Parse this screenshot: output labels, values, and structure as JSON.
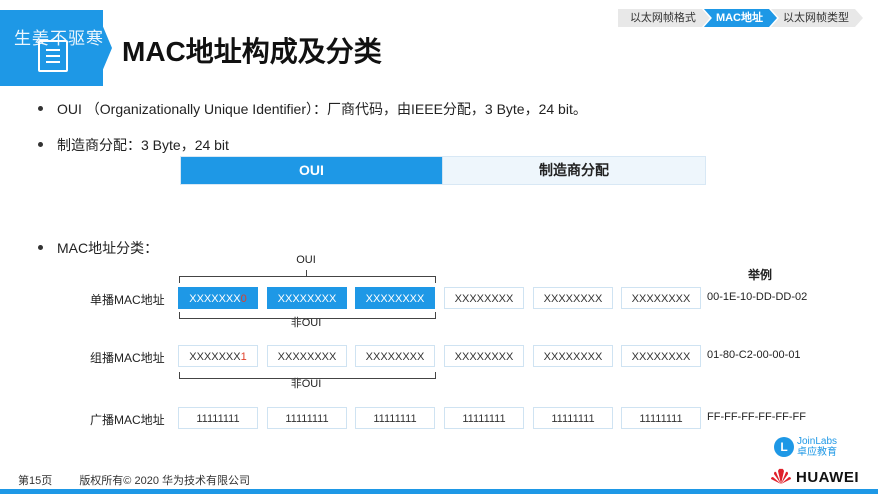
{
  "header": {
    "watermark": "生姜不驱寒",
    "title": "MAC地址构成及分类",
    "breadcrumbs": [
      "以太网帧格式",
      "MAC地址",
      "以太网帧类型"
    ],
    "active_crumb": 1
  },
  "bullets": {
    "oui": "OUI （Organizationally Unique Identifier）：厂商代码，由IEEE分配，3 Byte，24 bit。",
    "vendor": "制造商分配：3 Byte，24 bit",
    "classes": "MAC地址分类："
  },
  "oui_bar": {
    "left": "OUI",
    "right": "制造商分配"
  },
  "example_header": "举例",
  "brace_labels": {
    "unicast": "OUI",
    "multicast": "非OUI",
    "broadcast": "非OUI"
  },
  "rows": [
    {
      "label": "单播MAC地址",
      "cells": [
        "XXXXXXX",
        "XXXXXXXX",
        "XXXXXXXX",
        "XXXXXXXX",
        "XXXXXXXX",
        "XXXXXXXX"
      ],
      "special_bit": "0",
      "example": "00-1E-10-DD-DD-02"
    },
    {
      "label": "组播MAC地址",
      "cells": [
        "XXXXXXX",
        "XXXXXXXX",
        "XXXXXXXX",
        "XXXXXXXX",
        "XXXXXXXX",
        "XXXXXXXX"
      ],
      "special_bit": "1",
      "example": "01-80-C2-00-00-01"
    },
    {
      "label": "广播MAC地址",
      "cells": [
        "11111111",
        "11111111",
        "11111111",
        "11111111",
        "11111111",
        "11111111"
      ],
      "special_bit": "",
      "example": "FF-FF-FF-FF-FF-FF"
    }
  ],
  "footer": {
    "page": "第15页",
    "copyright": "版权所有© 2020 华为技术有限公司",
    "brand": "HUAWEI",
    "joinlabs_en": "JoinLabs",
    "joinlabs_cn": "卓应教育"
  },
  "colors": {
    "accent": "#1e98e6",
    "red_bit": "#e0402a"
  }
}
